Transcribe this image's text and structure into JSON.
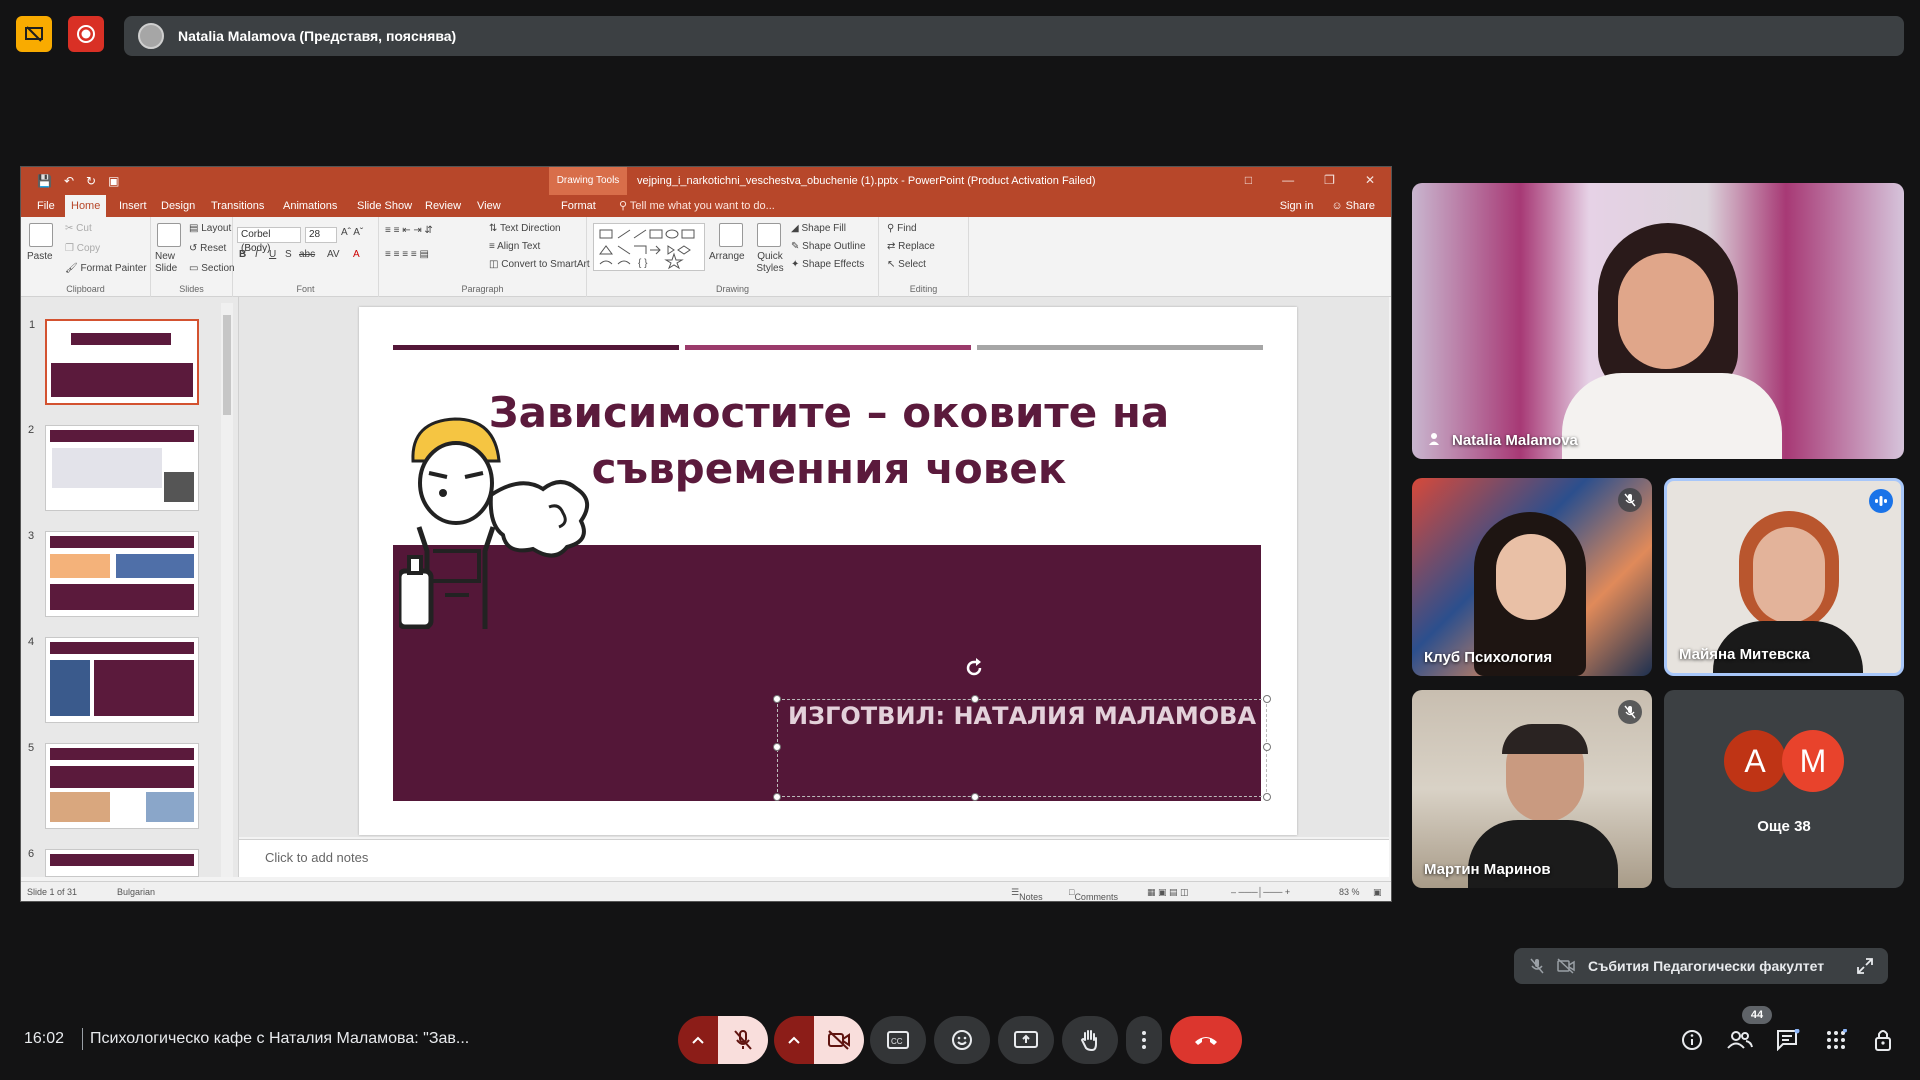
{
  "top_bar": {
    "presenter_label": "Natalia Malamova (Представя, пояснява)"
  },
  "ppt": {
    "drawing_tools": "Drawing Tools",
    "file_title": "vejping_i_narkotichni_veschestva_obuchenie (1).pptx - PowerPoint (Product Activation Failed)",
    "tabs": [
      "File",
      "Home",
      "Insert",
      "Design",
      "Transitions",
      "Animations",
      "Slide Show",
      "Review",
      "View",
      "Format"
    ],
    "tell_me": "Tell me what you want to do...",
    "sign_in": "Sign in",
    "share": "Share",
    "ribbon": {
      "paste": "Paste",
      "cut": "Cut",
      "copy": "Copy",
      "format_painter": "Format Painter",
      "clipboard": "Clipboard",
      "new_slide": "New Slide",
      "layout": "Layout",
      "reset": "Reset",
      "section": "Section",
      "slides": "Slides",
      "font_name": "Corbel (Body)",
      "font_size": "28",
      "font": "Font",
      "text_direction": "Text Direction",
      "align_text": "Align Text",
      "convert_smartart": "Convert to SmartArt",
      "paragraph": "Paragraph",
      "arrange": "Arrange",
      "quick_styles": "Quick Styles",
      "shape_fill": "Shape Fill",
      "shape_outline": "Shape Outline",
      "shape_effects": "Shape Effects",
      "drawing": "Drawing",
      "find": "Find",
      "replace": "Replace",
      "select": "Select",
      "editing": "Editing"
    },
    "slide_numbers": [
      "1",
      "2",
      "3",
      "4",
      "5",
      "6"
    ],
    "slide": {
      "title": "Зависимостите – оковите на съвременния човек",
      "author": "ИЗГОТВИЛ: НАТАЛИЯ МАЛАМОВА"
    },
    "notes_placeholder": "Click to add notes",
    "status": {
      "slide_of": "Slide 1 of 31",
      "language": "Bulgarian",
      "notes": "Notes",
      "comments": "Comments",
      "zoom": "83 %"
    },
    "colors": {
      "accent": "#b7472a",
      "slide_band": "#541738",
      "title": "#5b1a3c"
    }
  },
  "participants": {
    "main": "Natalia Malamova",
    "tile1": "Клуб Психология",
    "tile2": "Майяна Митевска",
    "tile3": "Мартин Маринов",
    "others_label": "Още 38",
    "avatar_a": "A",
    "avatar_m": "M"
  },
  "pip": {
    "label": "Събития Педагогически факултет"
  },
  "bottom": {
    "time": "16:02",
    "meeting_title": "Психологическо кафе с Наталия Маламова: \"Зав...",
    "participant_count": "44"
  }
}
